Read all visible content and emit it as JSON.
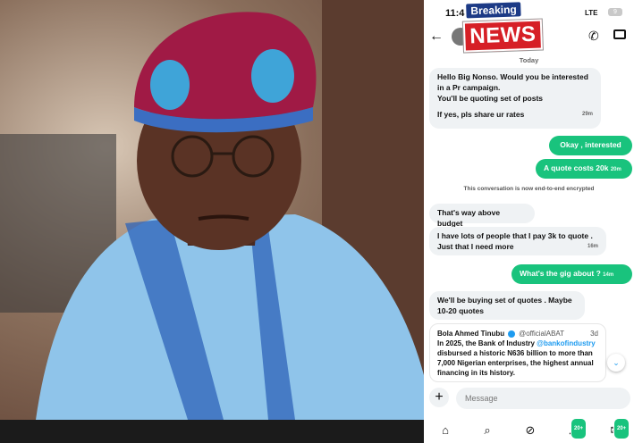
{
  "status_bar": {
    "time": "11:4",
    "network": "LTE",
    "battery": "9"
  },
  "header": {
    "back_icon": "arrow-left-icon",
    "call_icon": "phone-icon",
    "video_icon": "video-icon"
  },
  "overlay": {
    "breaking": "Breaking",
    "news": "NEWS"
  },
  "chat": {
    "day_label": "Today",
    "messages": [
      {
        "dir": "in",
        "text_lines": [
          "Hello Big Nonso. Would you be interested",
          "in a Pr campaign.",
          "You'll be quoting set of posts",
          "",
          "If yes, pls share ur rates"
        ],
        "time": "29m"
      },
      {
        "dir": "out",
        "text": "Okay , interested"
      },
      {
        "dir": "out",
        "text": "A quote costs 20k",
        "time": "20m"
      },
      {
        "dir": "in",
        "text": "That's way above budget"
      },
      {
        "dir": "in",
        "text_lines": [
          "I have lots of people that I pay 3k to quote .",
          "Just that I need more"
        ],
        "time": "16m"
      },
      {
        "dir": "out",
        "text": "What's the gig about ?",
        "time": "14m"
      },
      {
        "dir": "in",
        "text_lines": [
          "We'll be buying set of quotes . Maybe",
          "10-20 quotes"
        ]
      }
    ],
    "system_note": "This conversation is now end-to-end encrypted",
    "quoted_post": {
      "author": "Bola Ahmed Tinubu",
      "handle": "@officialABAT",
      "age": "3d",
      "text_before": "In 2025, the Bank of Industry",
      "mention": "@bankofindustry",
      "text_after": " disbursed a historic N636 billion to more than 7,000 Nigerian enterprises, the highest annual financing in its history."
    }
  },
  "composer": {
    "placeholder": "Message",
    "plus_icon": "plus-icon"
  },
  "tabs": [
    {
      "icon": "home-icon",
      "glyph": "⌂"
    },
    {
      "icon": "search-icon",
      "glyph": "⌕"
    },
    {
      "icon": "grok-icon",
      "glyph": "⊘"
    },
    {
      "icon": "bell-icon",
      "glyph": "♫",
      "badge": "20+"
    },
    {
      "icon": "mail-icon",
      "glyph": "✉",
      "badge": "20+"
    }
  ],
  "colors": {
    "outgoing": "#19c37d",
    "incoming": "#eff2f4",
    "accent": "#1d9bf0"
  }
}
